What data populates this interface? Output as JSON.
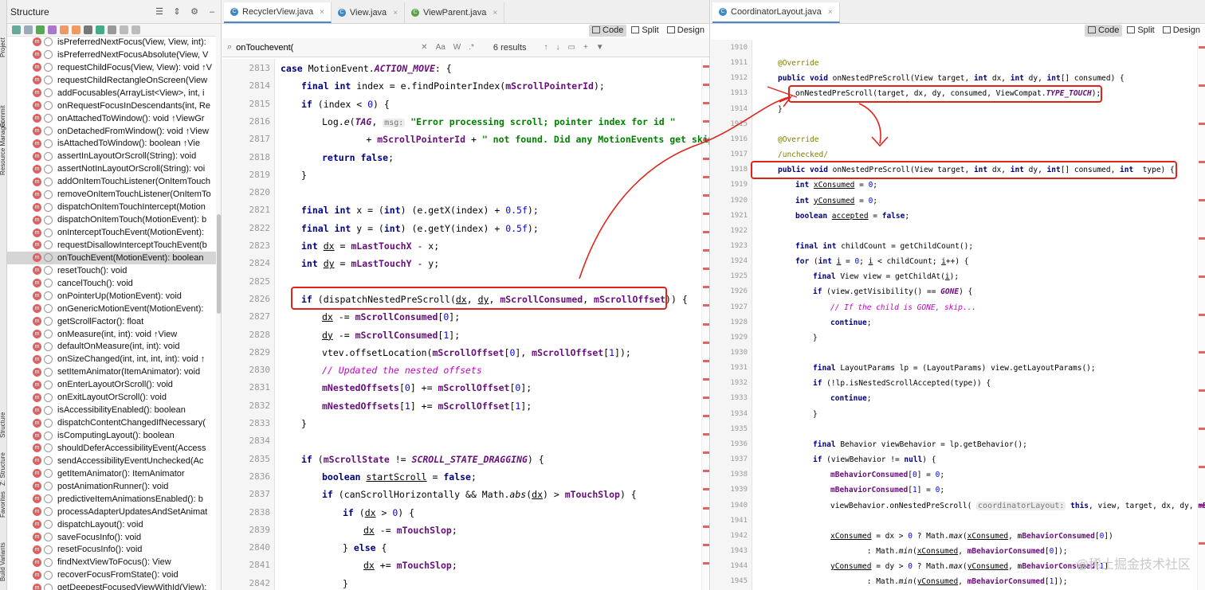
{
  "tool_window": {
    "left_labels": [
      "Project",
      "Commit",
      "Resource Manager",
      "Structure",
      "Z: Structure",
      "Favorites",
      "Build Variants"
    ]
  },
  "structure": {
    "title": "Structure",
    "methods": [
      {
        "text": "isPreferredNextFocus(View, View, int):",
        "selected": false
      },
      {
        "text": "isPreferredNextFocusAbsolute(View, V",
        "selected": false
      },
      {
        "text": "requestChildFocus(View, View): void ↑V",
        "selected": false
      },
      {
        "text": "requestChildRectangleOnScreen(View",
        "selected": false
      },
      {
        "text": "addFocusables(ArrayList<View>, int, i",
        "selected": false
      },
      {
        "text": "onRequestFocusInDescendants(int, Re",
        "selected": false
      },
      {
        "text": "onAttachedToWindow(): void ↑ViewGr",
        "selected": false
      },
      {
        "text": "onDetachedFromWindow(): void ↑View",
        "selected": false
      },
      {
        "text": "isAttachedToWindow(): boolean ↑Vie",
        "selected": false
      },
      {
        "text": "assertInLayoutOrScroll(String): void",
        "selected": false
      },
      {
        "text": "assertNotInLayoutOrScroll(String): voi",
        "selected": false
      },
      {
        "text": "addOnItemTouchListener(OnItemTouch",
        "selected": false
      },
      {
        "text": "removeOnItemTouchListener(OnItemTo",
        "selected": false
      },
      {
        "text": "dispatchOnItemTouchIntercept(Motion",
        "selected": false
      },
      {
        "text": "dispatchOnItemTouch(MotionEvent): b",
        "selected": false
      },
      {
        "text": "onInterceptTouchEvent(MotionEvent):",
        "selected": false
      },
      {
        "text": "requestDisallowInterceptTouchEvent(b",
        "selected": false
      },
      {
        "text": "onTouchEvent(MotionEvent): boolean",
        "selected": true
      },
      {
        "text": "resetTouch(): void",
        "selected": false
      },
      {
        "text": "cancelTouch(): void",
        "selected": false
      },
      {
        "text": "onPointerUp(MotionEvent): void",
        "selected": false
      },
      {
        "text": "onGenericMotionEvent(MotionEvent):",
        "selected": false
      },
      {
        "text": "getScrollFactor(): float",
        "selected": false
      },
      {
        "text": "onMeasure(int, int): void ↑View",
        "selected": false
      },
      {
        "text": "defaultOnMeasure(int, int): void",
        "selected": false
      },
      {
        "text": "onSizeChanged(int, int, int, int): void ↑",
        "selected": false
      },
      {
        "text": "setItemAnimator(ItemAnimator): void",
        "selected": false
      },
      {
        "text": "onEnterLayoutOrScroll(): void",
        "selected": false
      },
      {
        "text": "onExitLayoutOrScroll(): void",
        "selected": false
      },
      {
        "text": "isAccessibilityEnabled(): boolean",
        "selected": false
      },
      {
        "text": "dispatchContentChangedIfNecessary(",
        "selected": false
      },
      {
        "text": "isComputingLayout(): boolean",
        "selected": false
      },
      {
        "text": "shouldDeferAccessibilityEvent(Access",
        "selected": false
      },
      {
        "text": "sendAccessibilityEventUnchecked(Ac",
        "selected": false
      },
      {
        "text": "getItemAnimator(): ItemAnimator",
        "selected": false
      },
      {
        "text": "postAnimationRunner(): void",
        "selected": false
      },
      {
        "text": "predictiveItemAnimationsEnabled(): b",
        "selected": false
      },
      {
        "text": "processAdapterUpdatesAndSetAnimat",
        "selected": false
      },
      {
        "text": "dispatchLayout(): void",
        "selected": false
      },
      {
        "text": "saveFocusInfo(): void",
        "selected": false
      },
      {
        "text": "resetFocusInfo(): void",
        "selected": false
      },
      {
        "text": "findNextViewToFocus(): View",
        "selected": false
      },
      {
        "text": "recoverFocusFromState(): void",
        "selected": false
      },
      {
        "text": "getDeepestFocusedViewWithId(View):",
        "selected": false
      }
    ]
  },
  "left_editor": {
    "tabs": [
      "RecyclerView.java",
      "View.java",
      "ViewParent.java"
    ],
    "modes": [
      "Code",
      "Split",
      "Design"
    ],
    "search": {
      "query": "onTouchevent(",
      "results": "6 results",
      "case_label": "Aa",
      "words_label": "W",
      "regex_label": ".*"
    },
    "lines": [
      {
        "n": "2813",
        "html": "<span class=\"kw\">case</span> MotionEvent.<span class=\"fld it\">ACTION_MOVE</span>: {",
        "indent": 0
      },
      {
        "n": "2814",
        "html": "<span class=\"kw\">final int</span> index = e.findPointerIndex(<span class=\"fld\">mScrollPointerId</span>);",
        "indent": 1
      },
      {
        "n": "2815",
        "html": "<span class=\"kw\">if</span> (index &lt; <span class=\"num\">0</span>) {",
        "indent": 1
      },
      {
        "n": "2816",
        "html": "Log.<span class=\"it\">e</span>(<span class=\"fld it\">TAG</span>, <span class=\"hint\">msg:</span> <span class=\"str\">\"Error processing scroll; pointer index for id \"</span>",
        "indent": 2
      },
      {
        "n": "2817",
        "html": "        + <span class=\"fld\">mScrollPointerId</span> + <span class=\"str\">\" not found. Did any MotionEvents get skipped?\"</span>",
        "indent": 2
      },
      {
        "n": "2818",
        "html": "<span class=\"kw\">return false</span>;",
        "indent": 2
      },
      {
        "n": "2819",
        "html": "}",
        "indent": 1
      },
      {
        "n": "2820",
        "html": "",
        "indent": 0
      },
      {
        "n": "2821",
        "html": "<span class=\"kw\">final int</span> x = (<span class=\"kw\">int</span>) (e.getX(index) + <span class=\"num\">0.5f</span>);",
        "indent": 1
      },
      {
        "n": "2822",
        "html": "<span class=\"kw\">final int</span> y = (<span class=\"kw\">int</span>) (e.getY(index) + <span class=\"num\">0.5f</span>);",
        "indent": 1
      },
      {
        "n": "2823",
        "html": "<span class=\"kw\">int</span> <span class=\"ul\">dx</span> = <span class=\"fld\">mLastTouchX</span> - x;",
        "indent": 1
      },
      {
        "n": "2824",
        "html": "<span class=\"kw\">int</span> <span class=\"ul\">dy</span> = <span class=\"fld\">mLastTouchY</span> - y;",
        "indent": 1
      },
      {
        "n": "2825",
        "html": "",
        "indent": 0
      },
      {
        "n": "2826",
        "html": "<span class=\"kw\">if</span> (dispatchNestedPreScroll(<span class=\"ul\">dx</span>, <span class=\"ul\">dy</span>, <span class=\"fld\">mScrollConsumed</span>, <span class=\"fld\">mScrollOffset</span>)) {",
        "indent": 1
      },
      {
        "n": "2827",
        "html": "<span class=\"ul\">dx</span> -= <span class=\"fld\">mScrollConsumed</span>[<span class=\"num\">0</span>];",
        "indent": 2
      },
      {
        "n": "2828",
        "html": "<span class=\"ul\">dy</span> -= <span class=\"fld\">mScrollConsumed</span>[<span class=\"num\">1</span>];",
        "indent": 2
      },
      {
        "n": "2829",
        "html": "vtev.offsetLocation(<span class=\"fld\">mScrollOffset</span>[<span class=\"num\">0</span>], <span class=\"fld\">mScrollOffset</span>[<span class=\"num\">1</span>]);",
        "indent": 2
      },
      {
        "n": "2830",
        "html": "<span class=\"cmt\">// Updated the nested offsets</span>",
        "indent": 2
      },
      {
        "n": "2831",
        "html": "<span class=\"fld\">mNestedOffsets</span>[<span class=\"num\">0</span>] += <span class=\"fld\">mScrollOffset</span>[<span class=\"num\">0</span>];",
        "indent": 2
      },
      {
        "n": "2832",
        "html": "<span class=\"fld\">mNestedOffsets</span>[<span class=\"num\">1</span>] += <span class=\"fld\">mScrollOffset</span>[<span class=\"num\">1</span>];",
        "indent": 2
      },
      {
        "n": "2833",
        "html": "}",
        "indent": 1
      },
      {
        "n": "2834",
        "html": "",
        "indent": 0
      },
      {
        "n": "2835",
        "html": "<span class=\"kw\">if</span> (<span class=\"fld\">mScrollState</span> != <span class=\"fld it\">SCROLL_STATE_DRAGGING</span>) {",
        "indent": 1
      },
      {
        "n": "2836",
        "html": "<span class=\"kw\">boolean</span> <span class=\"ul\">startScroll</span> = <span class=\"kw\">false</span>;",
        "indent": 2
      },
      {
        "n": "2837",
        "html": "<span class=\"kw\">if</span> (canScrollHorizontally &amp;&amp; Math.<span class=\"it\">abs</span>(<span class=\"ul\">dx</span>) &gt; <span class=\"fld\">mTouchSlop</span>) {",
        "indent": 2
      },
      {
        "n": "2838",
        "html": "<span class=\"kw\">if</span> (<span class=\"ul\">dx</span> &gt; <span class=\"num\">0</span>) {",
        "indent": 3
      },
      {
        "n": "2839",
        "html": "<span class=\"ul\">dx</span> -= <span class=\"fld\">mTouchSlop</span>;",
        "indent": 4
      },
      {
        "n": "2840",
        "html": "} <span class=\"kw\">else</span> {",
        "indent": 3
      },
      {
        "n": "2841",
        "html": "<span class=\"ul\">dx</span> += <span class=\"fld\">mTouchSlop</span>;",
        "indent": 4
      },
      {
        "n": "2842",
        "html": "}",
        "indent": 3
      }
    ]
  },
  "right_editor": {
    "tabs": [
      "CoordinatorLayout.java"
    ],
    "modes": [
      "Code",
      "Split",
      "Design"
    ],
    "lines": [
      {
        "n": "1910",
        "html": "",
        "indent": 0
      },
      {
        "n": "1911",
        "html": "<span class=\"ann\">@Override</span>",
        "indent": 1
      },
      {
        "n": "1912",
        "html": "<span class=\"kw\">public void</span> onNestedPreScroll(View target, <span class=\"kw\">int</span> dx, <span class=\"kw\">int</span> dy, <span class=\"kw\">int</span>[] consumed) {",
        "indent": 1
      },
      {
        "n": "1913",
        "html": "onNestedPreScroll(target, dx, dy, consumed, ViewCompat.<span class=\"fld it\">TYPE_TOUCH</span>);",
        "indent": 2
      },
      {
        "n": "1914",
        "html": "}",
        "indent": 1
      },
      {
        "n": "1915",
        "html": "",
        "indent": 0
      },
      {
        "n": "1916",
        "html": "<span class=\"ann\">@Override</span>",
        "indent": 1
      },
      {
        "n": "1917",
        "html": "<span class=\"ann\">/unchecked/</span>",
        "indent": 1
      },
      {
        "n": "1918",
        "html": "<span class=\"kw\">public void</span> onNestedPreScroll(View target, <span class=\"kw\">int</span> dx, <span class=\"kw\">int</span> dy, <span class=\"kw\">int</span>[] consumed, <span class=\"kw\">int</span>  type) {",
        "indent": 1
      },
      {
        "n": "1919",
        "html": "<span class=\"kw\">int</span> <span class=\"ul\">xConsumed</span> = <span class=\"num\">0</span>;",
        "indent": 2
      },
      {
        "n": "1920",
        "html": "<span class=\"kw\">int</span> <span class=\"ul\">yConsumed</span> = <span class=\"num\">0</span>;",
        "indent": 2
      },
      {
        "n": "1921",
        "html": "<span class=\"kw\">boolean</span> <span class=\"ul\">accepted</span> = <span class=\"kw\">false</span>;",
        "indent": 2
      },
      {
        "n": "1922",
        "html": "",
        "indent": 0
      },
      {
        "n": "1923",
        "html": "<span class=\"kw\">final int</span> childCount = getChildCount();",
        "indent": 2
      },
      {
        "n": "1924",
        "html": "<span class=\"kw\">for</span> (<span class=\"kw\">int</span> <span class=\"ul\">i</span> = <span class=\"num\">0</span>; <span class=\"ul\">i</span> &lt; childCount; <span class=\"ul\">i</span>++) {",
        "indent": 2
      },
      {
        "n": "1925",
        "html": "<span class=\"kw\">final</span> View view = getChildAt(<span class=\"ul\">i</span>);",
        "indent": 3
      },
      {
        "n": "1926",
        "html": "<span class=\"kw\">if</span> (view.getVisibility() == <span class=\"fld it\">GONE</span>) {",
        "indent": 3
      },
      {
        "n": "1927",
        "html": "<span class=\"cmt\">// If the child is GONE, skip...</span>",
        "indent": 4
      },
      {
        "n": "1928",
        "html": "<span class=\"kw\">continue</span>;",
        "indent": 4
      },
      {
        "n": "1929",
        "html": "}",
        "indent": 3
      },
      {
        "n": "1930",
        "html": "",
        "indent": 0
      },
      {
        "n": "1931",
        "html": "<span class=\"kw\">final</span> LayoutParams lp = (LayoutParams) view.getLayoutParams();",
        "indent": 3
      },
      {
        "n": "1932",
        "html": "<span class=\"kw\">if</span> (!lp.isNestedScrollAccepted(type)) {",
        "indent": 3
      },
      {
        "n": "1933",
        "html": "<span class=\"kw\">continue</span>;",
        "indent": 4
      },
      {
        "n": "1934",
        "html": "}",
        "indent": 3
      },
      {
        "n": "1935",
        "html": "",
        "indent": 0
      },
      {
        "n": "1936",
        "html": "<span class=\"kw\">final</span> Behavior viewBehavior = lp.getBehavior();",
        "indent": 3
      },
      {
        "n": "1937",
        "html": "<span class=\"kw\">if</span> (viewBehavior != <span class=\"kw\">null</span>) {",
        "indent": 3
      },
      {
        "n": "1938",
        "html": "<span class=\"fld\">mBehaviorConsumed</span>[<span class=\"num\">0</span>] = <span class=\"num\">0</span>;",
        "indent": 4
      },
      {
        "n": "1939",
        "html": "<span class=\"fld\">mBehaviorConsumed</span>[<span class=\"num\">1</span>] = <span class=\"num\">0</span>;",
        "indent": 4
      },
      {
        "n": "1940",
        "html": "viewBehavior.onNestedPreScroll( <span class=\"hint\">coordinatorLayout:</span> <span class=\"kw\">this</span>, view, target, dx, dy, <span class=\"fld\">mBehavi</span>",
        "indent": 4
      },
      {
        "n": "1941",
        "html": "",
        "indent": 0
      },
      {
        "n": "1942",
        "html": "<span class=\"ul\">xConsumed</span> = dx &gt; <span class=\"num\">0</span> ? Math.<span class=\"it\">max</span>(<span class=\"ul\">xConsumed</span>, <span class=\"fld\">mBehaviorConsumed</span>[<span class=\"num\">0</span>])",
        "indent": 4
      },
      {
        "n": "1943",
        "html": "        : Math.<span class=\"it\">min</span>(<span class=\"ul\">xConsumed</span>, <span class=\"fld\">mBehaviorConsumed</span>[<span class=\"num\">0</span>]);",
        "indent": 4
      },
      {
        "n": "1944",
        "html": "<span class=\"ul\">yConsumed</span> = dy &gt; <span class=\"num\">0</span> ? Math.<span class=\"it\">max</span>(<span class=\"ul\">yConsumed</span>, <span class=\"fld\">mBehaviorConsumed</span>[<span class=\"num\">1</span>]",
        "indent": 4
      },
      {
        "n": "1945",
        "html": "        : Math.<span class=\"it\">min</span>(<span class=\"ul\">yConsumed</span>, <span class=\"fld\">mBehaviorConsumed</span>[<span class=\"num\">1</span>]);",
        "indent": 4
      }
    ]
  },
  "watermark": "@稀土掘金技术社区",
  "colors": {
    "annotation_red": "#e0241b",
    "selection": "#d5d5d5",
    "accent_tab": "#4a86c8"
  }
}
